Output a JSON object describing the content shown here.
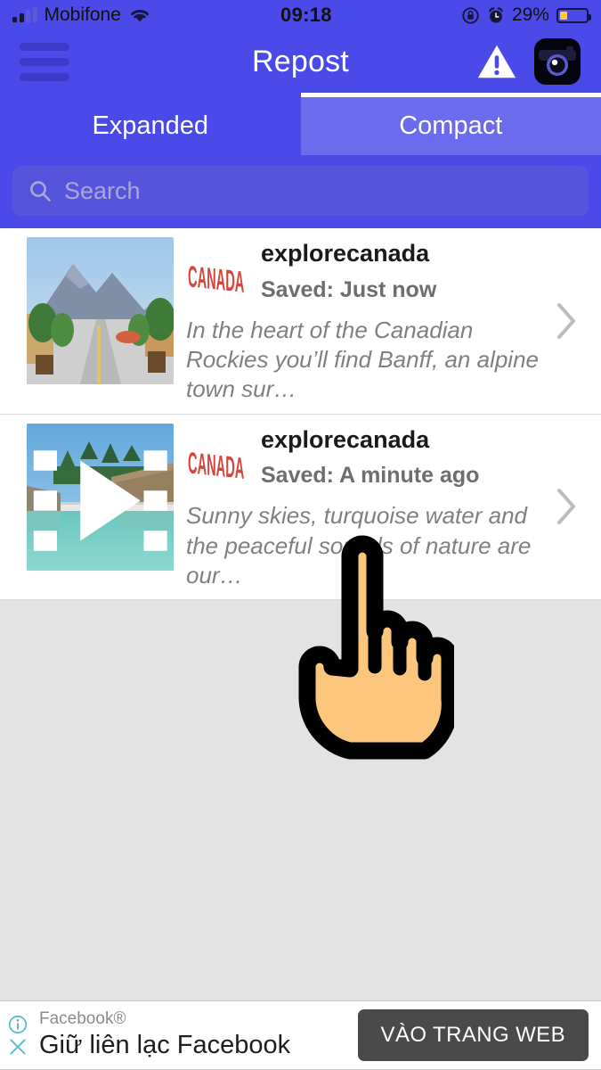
{
  "status_bar": {
    "carrier": "Mobifone",
    "time": "09:18",
    "battery_percent": "29%",
    "battery_level": 29,
    "icons": [
      "signal-bars-icon",
      "wifi-icon",
      "rotation-lock-icon",
      "alarm-clock-icon",
      "battery-icon"
    ]
  },
  "nav": {
    "title": "Repost",
    "menu_icon": "hamburger-menu-icon",
    "warning_icon": "warning-triangle-icon",
    "instagram_icon": "instagram-camera-icon"
  },
  "tabs": [
    {
      "label": "Expanded",
      "active": false
    },
    {
      "label": "Compact",
      "active": true
    }
  ],
  "search": {
    "placeholder": "Search",
    "value": "",
    "icon": "search-icon"
  },
  "posts": [
    {
      "username": "explorecanada",
      "saved": "Saved: Just now",
      "caption": "In the heart of the Canadian Rockies you’ll find Banff, an alpine town sur…",
      "avatar_text": "CANADA",
      "media_type": "image",
      "chevron": "chevron-right-icon"
    },
    {
      "username": "explorecanada",
      "saved": "Saved: A minute ago",
      "caption": "Sunny skies, turquoise water and the peaceful sounds of nature are our…",
      "avatar_text": "CANADA",
      "media_type": "video",
      "chevron": "chevron-right-icon"
    }
  ],
  "ad": {
    "brand": "Facebook®",
    "headline": "Giữ liên lạc Facebook",
    "cta": "VÀO TRANG WEB",
    "info_icon": "info-circle-icon",
    "close_icon": "close-x-icon"
  },
  "cursor": {
    "icon": "pointing-hand-cursor"
  },
  "colors": {
    "header_blue": "#4A4AE8",
    "tab_active_blue": "#6B6BEE",
    "search_blue": "#5454DD",
    "page_grey": "#E3E3E3",
    "avatar_red": "#D6453C",
    "ad_button": "#4A4A4A",
    "battery_yellow": "#FFCC3D",
    "hand_fill": "#FCC77C"
  }
}
